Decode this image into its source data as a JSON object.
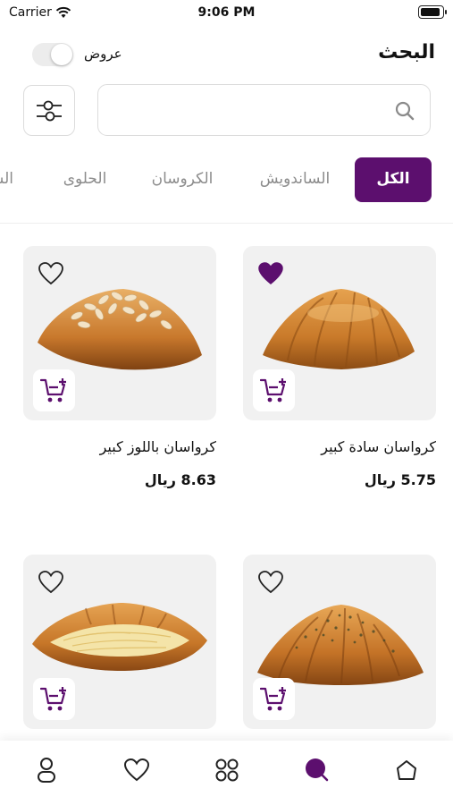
{
  "status_bar": {
    "carrier": "Carrier",
    "time": "9:06 PM"
  },
  "header": {
    "title": "البحث",
    "offers_label": "عروض",
    "offers_enabled": false
  },
  "search": {
    "value": "",
    "placeholder": ""
  },
  "tabs": [
    {
      "label": "الكل",
      "active": true
    },
    {
      "label": "الساندويش",
      "active": false
    },
    {
      "label": "الكروسان",
      "active": false
    },
    {
      "label": "الحلوى",
      "active": false
    },
    {
      "label": "السـ",
      "active": false
    }
  ],
  "products": [
    {
      "name": "كرواسان سادة كبير",
      "price": "5.75 ريال",
      "favorite": true
    },
    {
      "name": "كرواسان باللوز كبير",
      "price": "8.63 ريال",
      "favorite": false
    },
    {
      "name": "",
      "price": "",
      "favorite": false
    },
    {
      "name": "",
      "price": "",
      "favorite": false
    }
  ],
  "bottom_nav": [
    {
      "icon": "home-icon",
      "active": false
    },
    {
      "icon": "search-icon",
      "active": true
    },
    {
      "icon": "categories-icon",
      "active": false
    },
    {
      "icon": "heart-icon",
      "active": false
    },
    {
      "icon": "profile-icon",
      "active": false
    }
  ],
  "colors": {
    "accent": "#5c0f6e",
    "card_bg": "#f1f1f1",
    "tab_inactive": "#8c8c8c"
  }
}
